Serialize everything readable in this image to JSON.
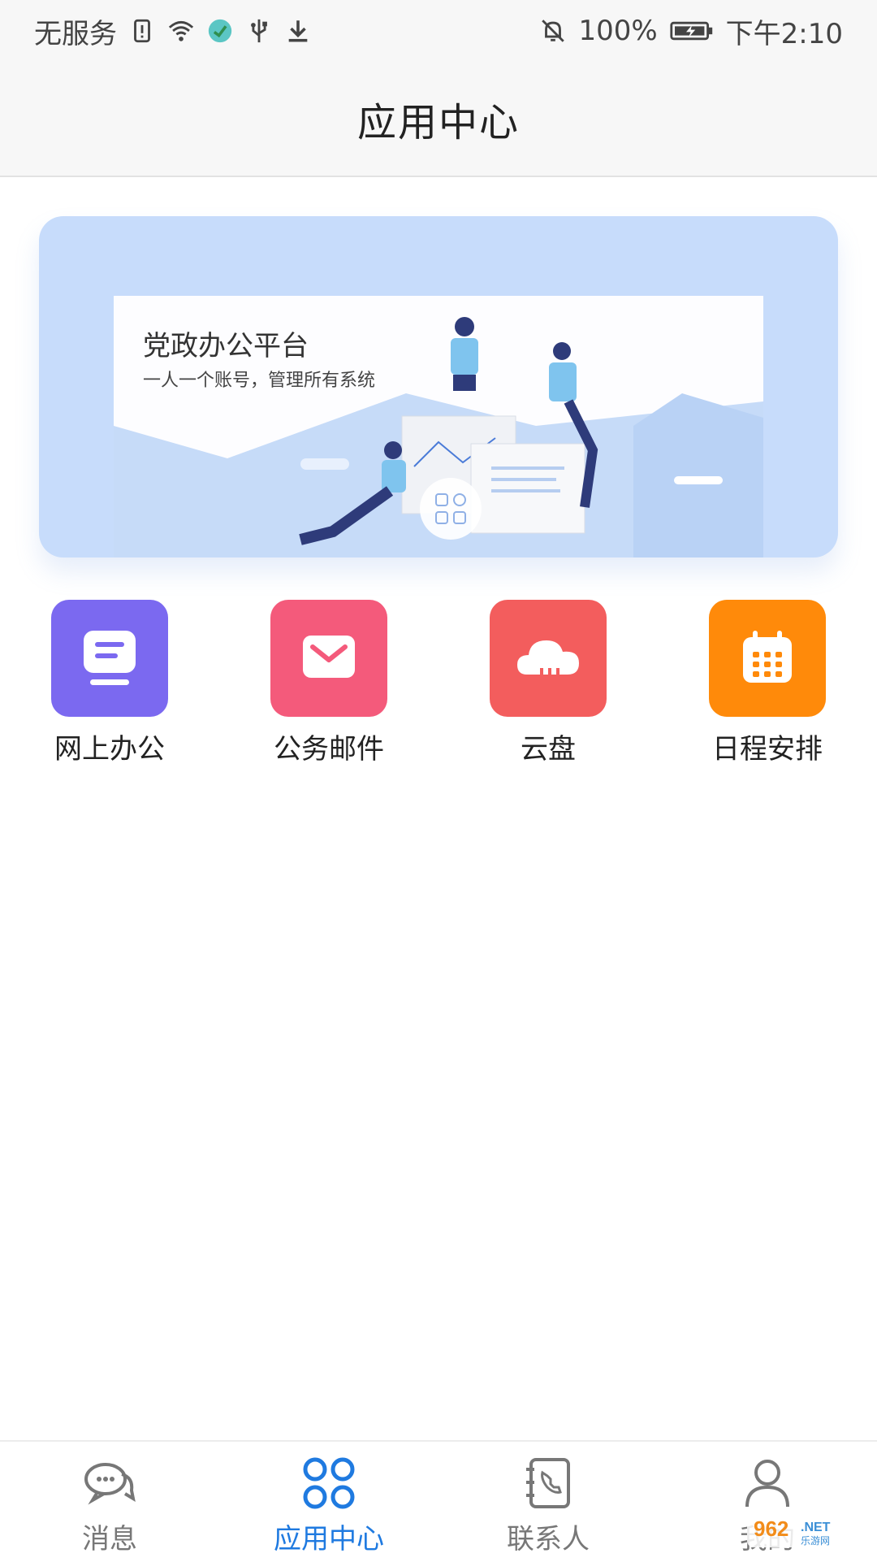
{
  "status_bar": {
    "carrier": "无服务",
    "battery_percent": "100%",
    "time": "下午2:10",
    "icons_left": [
      "sim-alert-icon",
      "wifi-icon",
      "app-notification-icon",
      "usb-icon",
      "download-icon"
    ],
    "icons_right": [
      "mute-bell-icon",
      "battery-charging-icon"
    ]
  },
  "header": {
    "title": "应用中心"
  },
  "banner": {
    "title": "党政办公平台",
    "subtitle": "一人一个账号，管理所有系统",
    "colors": {
      "background": "#c7dcfb",
      "card": "#fdfdff"
    }
  },
  "apps": [
    {
      "label": "网上办公",
      "icon": "online-office-icon",
      "color": "#7b69f0"
    },
    {
      "label": "公务邮件",
      "icon": "mail-icon",
      "color": "#f45a7b"
    },
    {
      "label": "云盘",
      "icon": "cloud-icon",
      "color": "#f35d5d"
    },
    {
      "label": "日程安排",
      "icon": "calendar-icon",
      "color": "#ff8a0a"
    }
  ],
  "bottom_nav": {
    "items": [
      {
        "label": "消息",
        "icon": "message-bubbles-icon",
        "active": false
      },
      {
        "label": "应用中心",
        "icon": "apps-grid-icon",
        "active": true
      },
      {
        "label": "联系人",
        "icon": "contacts-phone-icon",
        "active": false
      },
      {
        "label": "我的",
        "icon": "profile-icon",
        "active": false
      }
    ],
    "active_color": "#1f7ae0",
    "inactive_color": "#777777"
  },
  "watermark": {
    "text": "962.NET",
    "subtext": "乐游网"
  }
}
